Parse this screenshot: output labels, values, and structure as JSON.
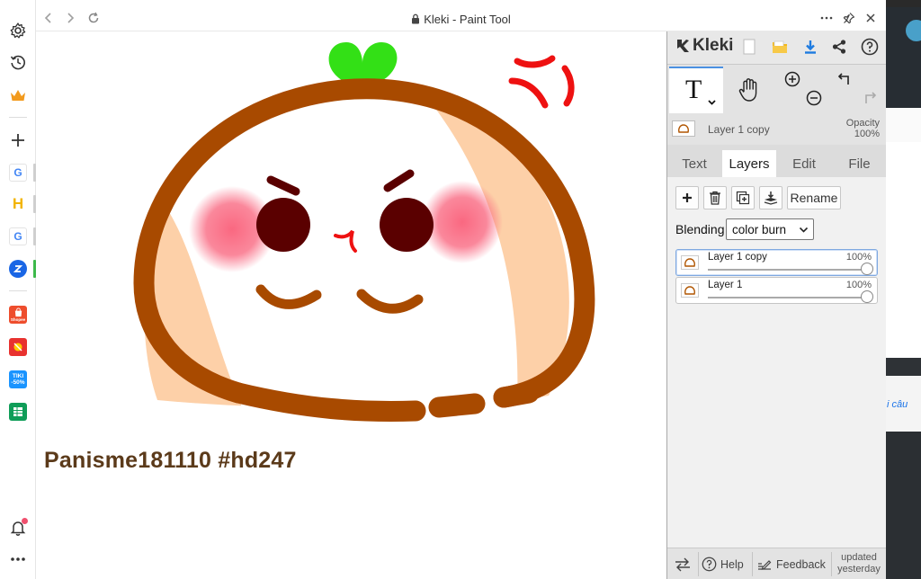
{
  "window": {
    "title": "Kleki - Paint Tool"
  },
  "browser_sidebar": {
    "items": [
      {
        "icon": "settings-icon"
      },
      {
        "icon": "history-icon"
      },
      {
        "icon": "crown-icon"
      },
      {
        "icon": "add-icon"
      },
      {
        "icon": "google-icon",
        "label": "G"
      },
      {
        "icon": "h-app-icon",
        "label": "H"
      },
      {
        "icon": "google-icon",
        "label": "G"
      },
      {
        "icon": "zalo-icon"
      },
      {
        "icon": "shopee-icon",
        "label": "Shopee"
      },
      {
        "icon": "game-icon"
      },
      {
        "icon": "tiki-icon",
        "label": "TIKI -50%"
      },
      {
        "icon": "sheets-icon"
      },
      {
        "icon": "bell-icon"
      },
      {
        "icon": "more-icon"
      }
    ]
  },
  "canvas": {
    "signature": "Panisme181110 #hd247"
  },
  "kleki": {
    "brand": "Kleki",
    "layer_info": {
      "name": "Layer 1 copy",
      "opacity_label": "Opacity",
      "opacity_value": "100%"
    },
    "tabs": [
      {
        "label": "Text",
        "active": false
      },
      {
        "label": "Layers",
        "active": true
      },
      {
        "label": "Edit",
        "active": false
      },
      {
        "label": "File",
        "active": false
      }
    ],
    "layer_buttons": {
      "rename": "Rename"
    },
    "blending": {
      "label": "Blending",
      "value": "color burn"
    },
    "layers": [
      {
        "name": "Layer 1 copy",
        "opacity": "100%",
        "selected": true
      },
      {
        "name": "Layer 1",
        "opacity": "100%",
        "selected": false
      }
    ],
    "footer": {
      "help": "Help",
      "feedback": "Feedback",
      "updated_line1": "updated",
      "updated_line2": "yesterday"
    }
  },
  "background_page": {
    "snippet": "i câu"
  },
  "colors": {
    "outline": "#a84a00",
    "cheek": "#f9607a",
    "sprout": "#33e016",
    "anger_mark": "#ee1111",
    "side_shade": "#fdd0a8",
    "tab_accent": "#4a90e2"
  }
}
